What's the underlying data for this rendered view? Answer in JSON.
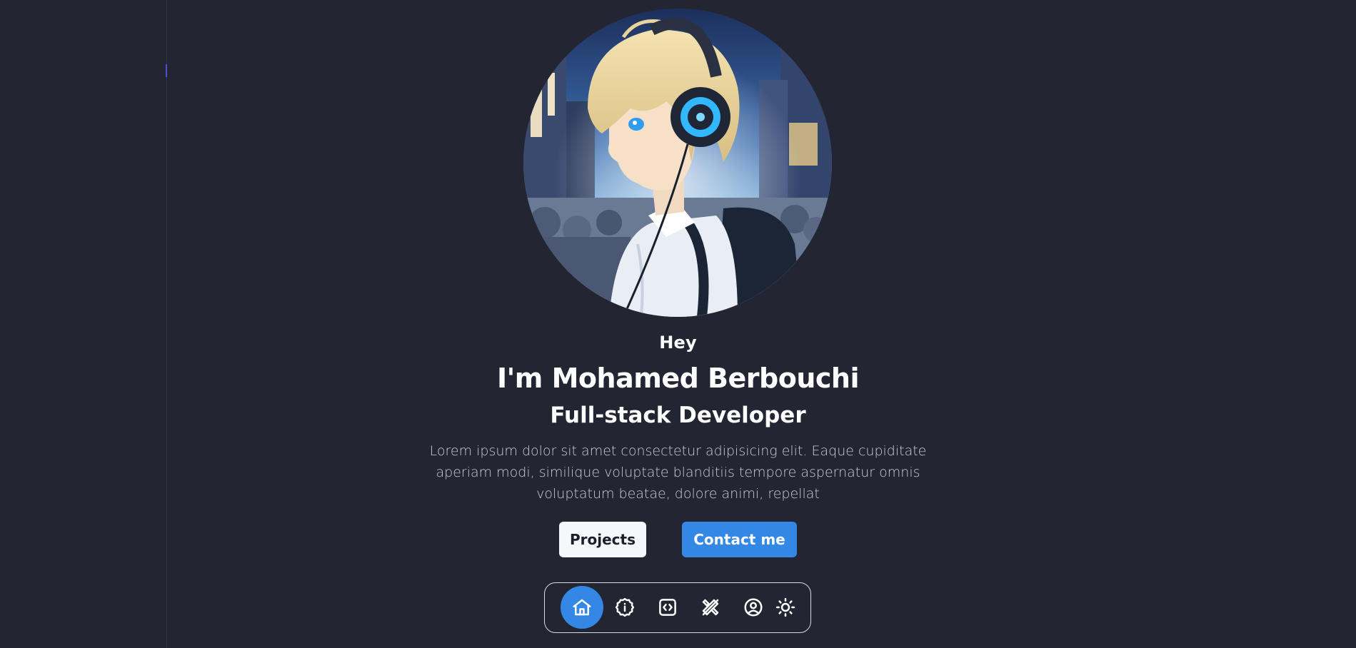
{
  "hero": {
    "greeting": "Hey",
    "name": "I'm Mohamed Berbouchi",
    "role": "Full-stack Developer",
    "bio": "Lorem ipsum dolor sit amet consectetur adipisicing elit. Eaque cupiditate aperiam modi, similique voluptate blanditiis tempore aspernatur omnis voluptatum beatae, dolore animi, repellat",
    "avatar_icon": "anime-avatar-with-headphones"
  },
  "buttons": {
    "projects_label": "Projects",
    "contact_label": "Contact me"
  },
  "dock": {
    "items": [
      {
        "icon": "home-icon",
        "active": true
      },
      {
        "icon": "info-icon",
        "active": false
      },
      {
        "icon": "code-icon",
        "active": false
      },
      {
        "icon": "tools-icon",
        "active": false
      },
      {
        "icon": "user-circle-icon",
        "active": false
      },
      {
        "icon": "sun-icon",
        "active": false
      }
    ]
  },
  "colors": {
    "background": "#232632",
    "accent": "#3388e6",
    "text": "#ffffff",
    "muted_text": "#c9ccd6",
    "light_button": "#f5f7fa"
  }
}
